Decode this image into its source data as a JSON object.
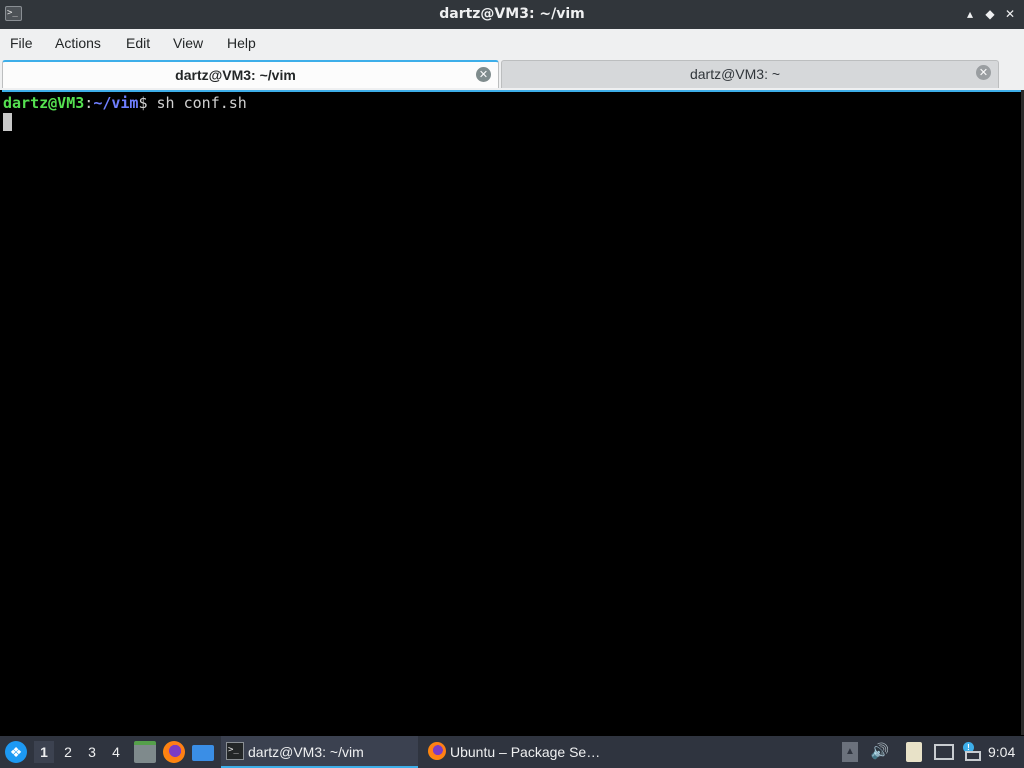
{
  "window": {
    "title": "dartz@VM3: ~/vim",
    "app_icon_glyph": ">_",
    "controls": {
      "minimize": "▴",
      "restore": "◆",
      "close": "✕"
    }
  },
  "menubar": {
    "file": "File",
    "actions": "Actions",
    "edit": "Edit",
    "view": "View",
    "help": "Help"
  },
  "tabs": [
    {
      "label": "dartz@VM3: ~/vim",
      "active": true
    },
    {
      "label": "dartz@VM3: ~",
      "active": false
    }
  ],
  "terminal": {
    "prompt_user": "dartz@VM3",
    "prompt_sep": ":",
    "prompt_path": "~/vim",
    "prompt_dollar": "$",
    "command": " sh conf.sh"
  },
  "taskbar": {
    "workspaces": [
      "1",
      "2",
      "3",
      "4"
    ],
    "active_workspace": "1",
    "tasks": [
      {
        "label": "dartz@VM3: ~/vim",
        "icon": "terminal-icon",
        "active": true
      },
      {
        "label": "Ubuntu – Package Se…",
        "icon": "firefox-icon",
        "active": false
      }
    ],
    "clock": "9:04"
  },
  "colors": {
    "accent": "#3daee9",
    "prompt_user": "#55e050",
    "prompt_path": "#6f7fff",
    "titlebar_bg": "#31363b",
    "taskbar_bg": "#2f343f"
  }
}
